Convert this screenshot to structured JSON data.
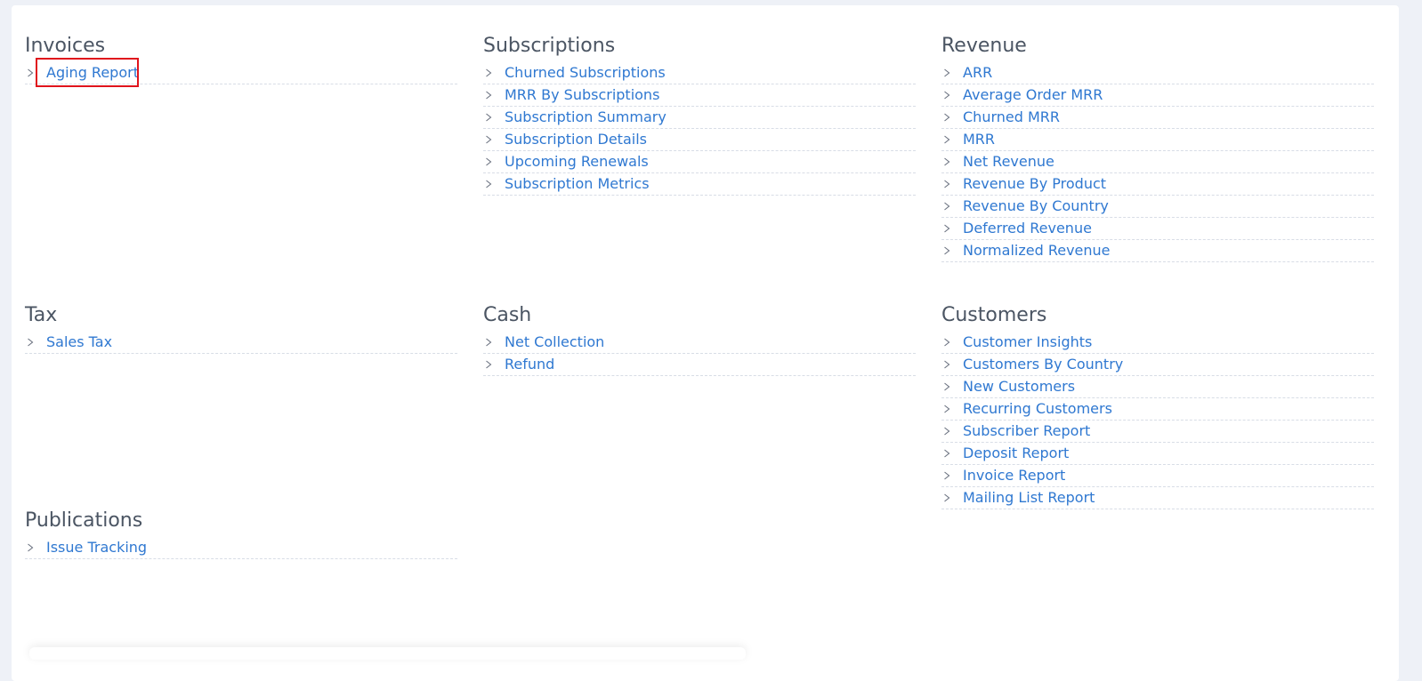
{
  "sections": {
    "invoices": {
      "title": "Invoices",
      "items": [
        "Aging Report"
      ]
    },
    "subscriptions": {
      "title": "Subscriptions",
      "items": [
        "Churned Subscriptions",
        "MRR By Subscriptions",
        "Subscription Summary",
        "Subscription Details",
        "Upcoming Renewals",
        "Subscription Metrics"
      ]
    },
    "revenue": {
      "title": "Revenue",
      "items": [
        "ARR",
        "Average Order MRR",
        "Churned MRR",
        "MRR",
        "Net Revenue",
        "Revenue By Product",
        "Revenue By Country",
        "Deferred Revenue",
        "Normalized Revenue"
      ]
    },
    "tax": {
      "title": "Tax",
      "items": [
        "Sales Tax"
      ]
    },
    "cash": {
      "title": "Cash",
      "items": [
        "Net Collection",
        "Refund"
      ]
    },
    "customers": {
      "title": "Customers",
      "items": [
        "Customer Insights",
        "Customers By Country",
        "New Customers",
        "Recurring Customers",
        "Subscriber Report",
        "Deposit Report",
        "Invoice Report",
        "Mailing List Report"
      ]
    },
    "publications": {
      "title": "Publications",
      "items": [
        "Issue Tracking"
      ]
    }
  },
  "colors": {
    "link": "#2f78d1",
    "heading": "#4b5563",
    "highlight": "#e0141c"
  },
  "icons": {
    "item_marker": "chevron-right-icon"
  }
}
